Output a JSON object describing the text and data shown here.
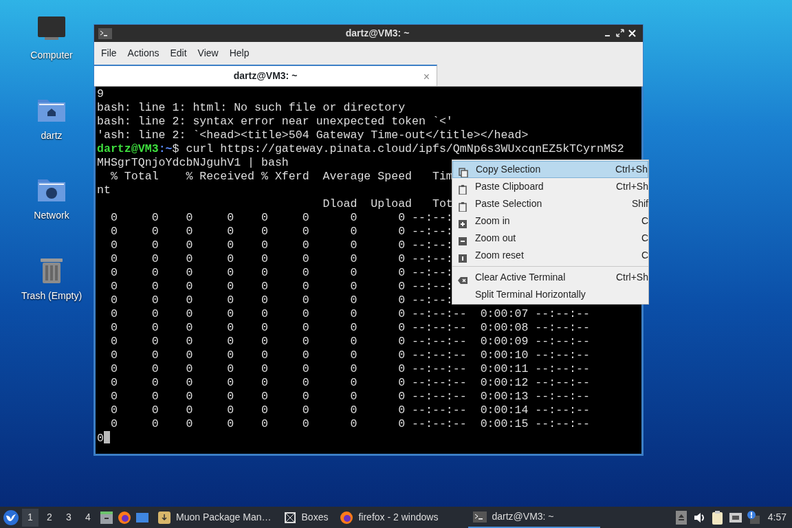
{
  "desktop_icons": [
    {
      "kind": "computer",
      "label": "Computer"
    },
    {
      "kind": "home",
      "label": "dartz"
    },
    {
      "kind": "network",
      "label": "Network"
    },
    {
      "kind": "trash",
      "label": "Trash (Empty)"
    }
  ],
  "window": {
    "title": "dartz@VM3: ~",
    "menu": [
      "File",
      "Actions",
      "Edit",
      "View",
      "Help"
    ],
    "tabs": [
      {
        "label": "dartz@VM3: ~",
        "selected": true,
        "close": "×"
      }
    ],
    "terminal_lines": [
      {
        "kind": "text",
        "text": "9"
      },
      {
        "kind": "text",
        "text": "bash: line 1: html: No such file or directory"
      },
      {
        "kind": "text",
        "text": "bash: line 2: syntax error near unexpected token `<'"
      },
      {
        "kind": "text",
        "text": "'ash: line 2: `<head><title>504 Gateway Time-out</title></head>"
      },
      {
        "kind": "prompt",
        "user": "dartz@VM3",
        "path": ":~",
        "text": "$ curl https://gateway.pinata.cloud/ipfs/QmNp6s3WUxcqnEZ5kTCyrnMS2"
      },
      {
        "kind": "text",
        "text": "MHSgrTQnjoYdcbNJguhV1 | bash"
      },
      {
        "kind": "text",
        "text": "  % Total    % Received % Xferd  Average Speed   Tim"
      },
      {
        "kind": "text",
        "text": "nt"
      },
      {
        "kind": "text",
        "text": "                                 Dload  Upload   Tot"
      },
      {
        "kind": "text",
        "text": "  0     0    0     0    0     0      0      0 --:--:"
      },
      {
        "kind": "text",
        "text": "  0     0    0     0    0     0      0      0 --:--:"
      },
      {
        "kind": "text",
        "text": "  0     0    0     0    0     0      0      0 --:--:"
      },
      {
        "kind": "text",
        "text": "  0     0    0     0    0     0      0      0 --:--:"
      },
      {
        "kind": "text",
        "text": "  0     0    0     0    0     0      0      0 --:--:"
      },
      {
        "kind": "text",
        "text": "  0     0    0     0    0     0      0      0 --:--:"
      },
      {
        "kind": "text",
        "text": "  0     0    0     0    0     0      0      0 --:--:"
      },
      {
        "kind": "text",
        "text": "  0     0    0     0    0     0      0      0 --:--:--  0:00:07 --:--:--"
      },
      {
        "kind": "text",
        "text": "  0     0    0     0    0     0      0      0 --:--:--  0:00:08 --:--:--"
      },
      {
        "kind": "text",
        "text": "  0     0    0     0    0     0      0      0 --:--:--  0:00:09 --:--:--"
      },
      {
        "kind": "text",
        "text": "  0     0    0     0    0     0      0      0 --:--:--  0:00:10 --:--:--"
      },
      {
        "kind": "text",
        "text": "  0     0    0     0    0     0      0      0 --:--:--  0:00:11 --:--:--"
      },
      {
        "kind": "text",
        "text": "  0     0    0     0    0     0      0      0 --:--:--  0:00:12 --:--:--"
      },
      {
        "kind": "text",
        "text": "  0     0    0     0    0     0      0      0 --:--:--  0:00:13 --:--:--"
      },
      {
        "kind": "text",
        "text": "  0     0    0     0    0     0      0      0 --:--:--  0:00:14 --:--:--"
      },
      {
        "kind": "text",
        "text": "  0     0    0     0    0     0      0      0 --:--:--  0:00:15 --:--:--"
      },
      {
        "kind": "cursor",
        "text": "0"
      }
    ]
  },
  "context_menu": [
    {
      "label": "Copy Selection",
      "shortcut": "Ctrl+Sh",
      "selected": true
    },
    {
      "label": "Paste Clipboard",
      "shortcut": "Ctrl+Sh",
      "selected": false
    },
    {
      "label": "Paste Selection",
      "shortcut": "Shif",
      "selected": false
    },
    {
      "label": "Zoom in",
      "shortcut": "C",
      "selected": false
    },
    {
      "label": "Zoom out",
      "shortcut": "C",
      "selected": false
    },
    {
      "label": "Zoom reset",
      "shortcut": "C",
      "selected": false
    },
    {
      "label": "Clear Active Terminal",
      "shortcut": "Ctrl+Sh",
      "selected": false
    },
    {
      "label": "Split Terminal Horizontally",
      "selected": false
    }
  ],
  "taskbar": {
    "workspaces": [
      {
        "label": "1",
        "selected": true
      },
      {
        "label": "2",
        "selected": false
      },
      {
        "label": "3",
        "selected": false
      },
      {
        "label": "4",
        "selected": false
      }
    ],
    "tasks": [
      {
        "label": "Muon Package Man…",
        "selected": false
      },
      {
        "label": "Boxes",
        "selected": false
      },
      {
        "label": "firefox - 2 windows",
        "selected": false
      },
      {
        "label": "dartz@VM3: ~",
        "selected": true
      }
    ],
    "clock": "4:57"
  }
}
